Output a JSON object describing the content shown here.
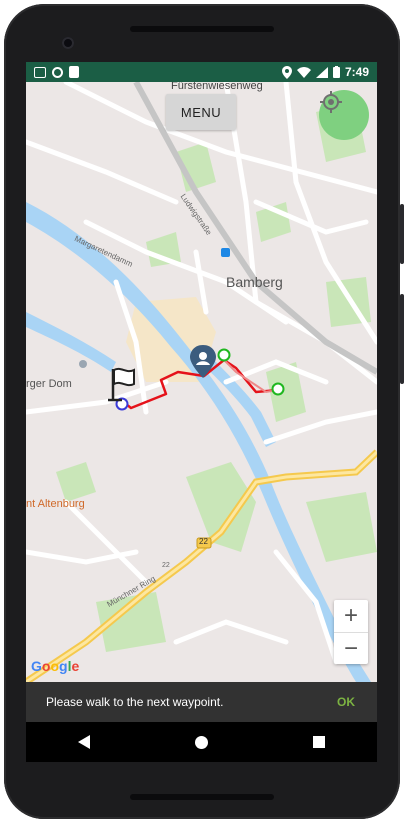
{
  "status_bar": {
    "time": "7:49"
  },
  "menu_button": {
    "label": "MENU"
  },
  "map": {
    "labels": {
      "street_top": "Fürstenwiesenweg",
      "city": "Bamberg",
      "dom": "rger Dom",
      "altenburg": "nt Altenburg",
      "road_number": "22",
      "road_number_2": "22",
      "muenchner_ring": "Münchner Ring",
      "margaretendamm": "Margaretendamm",
      "ludwigstr": "Ludwigstraße"
    }
  },
  "zoom": {
    "in_label": "+",
    "out_label": "−"
  },
  "google": {
    "letters": [
      "G",
      "o",
      "o",
      "g",
      "l",
      "e"
    ]
  },
  "snackbar": {
    "message": "Please walk to the next waypoint.",
    "action": "OK"
  },
  "colors": {
    "route": "#e5121a",
    "waypoint": "#1fb71f",
    "locate": "#7fd080",
    "statusbar": "#1b5e45",
    "snack_action": "#7cb342"
  }
}
